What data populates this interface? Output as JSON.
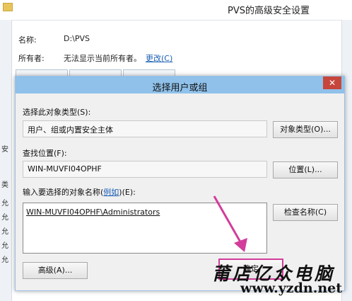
{
  "background_window": {
    "title": "PVS的高级安全设置",
    "name_label": "名称:",
    "name_value": "D:\\PVS",
    "owner_label": "所有者:",
    "owner_value": "无法显示当前所有者。",
    "change_link": "更改(C)",
    "side_chars": [
      "安",
      "类",
      "允",
      "允",
      "允",
      "允",
      "允"
    ]
  },
  "dialog": {
    "title": "选择用户或组",
    "close_label": "✕",
    "object_type_label": "选择此对象类型(S):",
    "object_type_value": "用户、组或内置安全主体",
    "object_type_button": "对象类型(O)...",
    "location_label": "查找位置(F):",
    "location_value": "WIN-MUVFI04OPHF",
    "location_button": "位置(L)...",
    "names_label_prefix": "输入要选择的对象名称(",
    "names_label_link": "例如",
    "names_label_suffix": ")(E):",
    "names_value": "WIN-MUVFI04OPHF\\Administrators",
    "check_names_button": "检查名称(C)",
    "advanced_button": "高级(A)...",
    "ok_button": "确定"
  },
  "watermark": {
    "line1": "莆店亿众电脑",
    "line2": "www.yzdn.net"
  },
  "colors": {
    "dialog_title_bg": "#8fc1ea",
    "close_button": "#c7463c",
    "annotation": "#d23d9b",
    "link": "#1a5fb4"
  }
}
